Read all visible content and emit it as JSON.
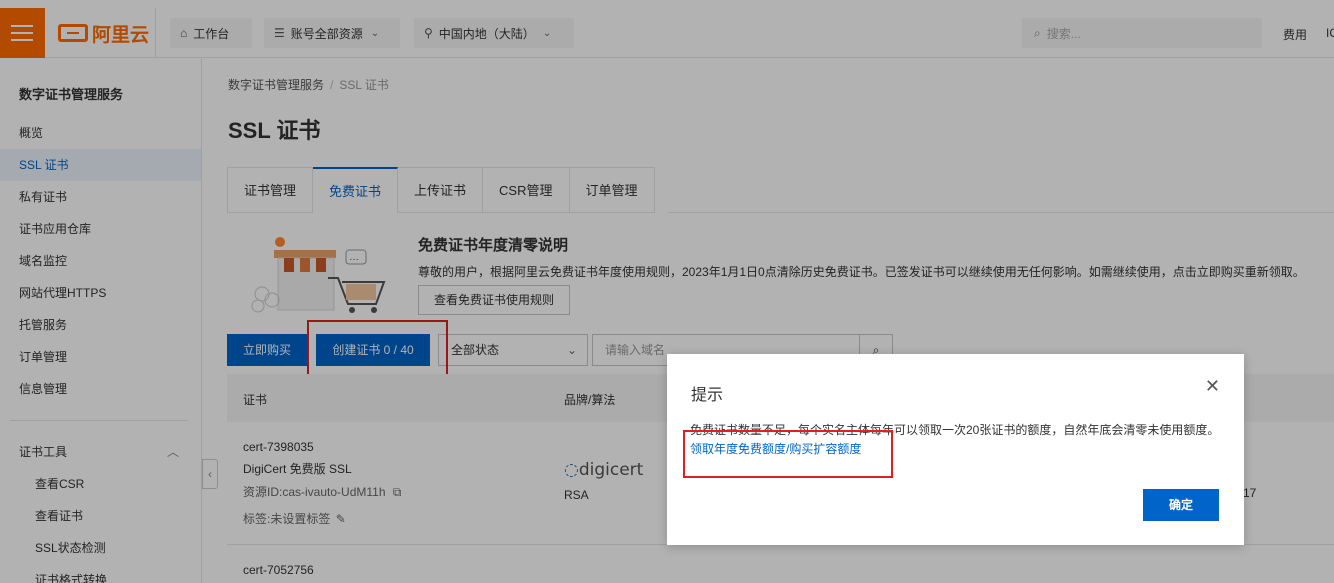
{
  "topbar": {
    "logo_text": "阿里云",
    "workbench": "工作台",
    "resources": "账号全部资源",
    "region": "中国内地（大陆）",
    "search_placeholder": "搜索...",
    "fee": "费用",
    "ic": "IC"
  },
  "sidebar": {
    "title": "数字证书管理服务",
    "items": [
      "概览",
      "SSL 证书",
      "私有证书",
      "证书应用仓库",
      "域名监控",
      "网站代理HTTPS",
      "托管服务",
      "订单管理",
      "信息管理"
    ],
    "tools_label": "证书工具",
    "tools": [
      "查看CSR",
      "查看证书",
      "SSL状态检测",
      "证书格式转换"
    ]
  },
  "breadcrumb": {
    "root": "数字证书管理服务",
    "current": "SSL 证书"
  },
  "page_title": "SSL 证书",
  "tabs": [
    "证书管理",
    "免费证书",
    "上传证书",
    "CSR管理",
    "订单管理"
  ],
  "notice": {
    "title": "免费证书年度清零说明",
    "text": "尊敬的用户，根据阿里云免费证书年度使用规则，2023年1月1日0点清除历史免费证书。已签发证书可以继续使用无任何影响。如需继续使用，点击立即购买重新领取。",
    "rules_button": "查看免费证书使用规则"
  },
  "actions": {
    "buy": "立即购买",
    "create": "创建证书 0 / 40",
    "status_select": "全部状态",
    "domain_placeholder": "请输入域名"
  },
  "table": {
    "headers": [
      "证书",
      "品牌/算法"
    ],
    "rows": [
      {
        "id": "cert-7398035",
        "name": "DigiCert 免费版 SSL",
        "resource_id": "资源ID:cas-ivauto-UdM11h",
        "tag": "标签:未设置标签",
        "brand": "digicert",
        "algo": "RSA",
        "trailing": "17"
      },
      {
        "id": "cert-7052756"
      }
    ]
  },
  "dialog": {
    "title": "提示",
    "text": "免费证书数量不足，每个实名主体每年可以领取一次20张证书的额度，自然年底会清零未使用额度。",
    "link": "领取年度免费额度/购买扩容额度",
    "ok": "确定"
  },
  "colors": {
    "accent": "#0064c8",
    "brand": "#ff6a00",
    "highlight": "#e02020"
  }
}
